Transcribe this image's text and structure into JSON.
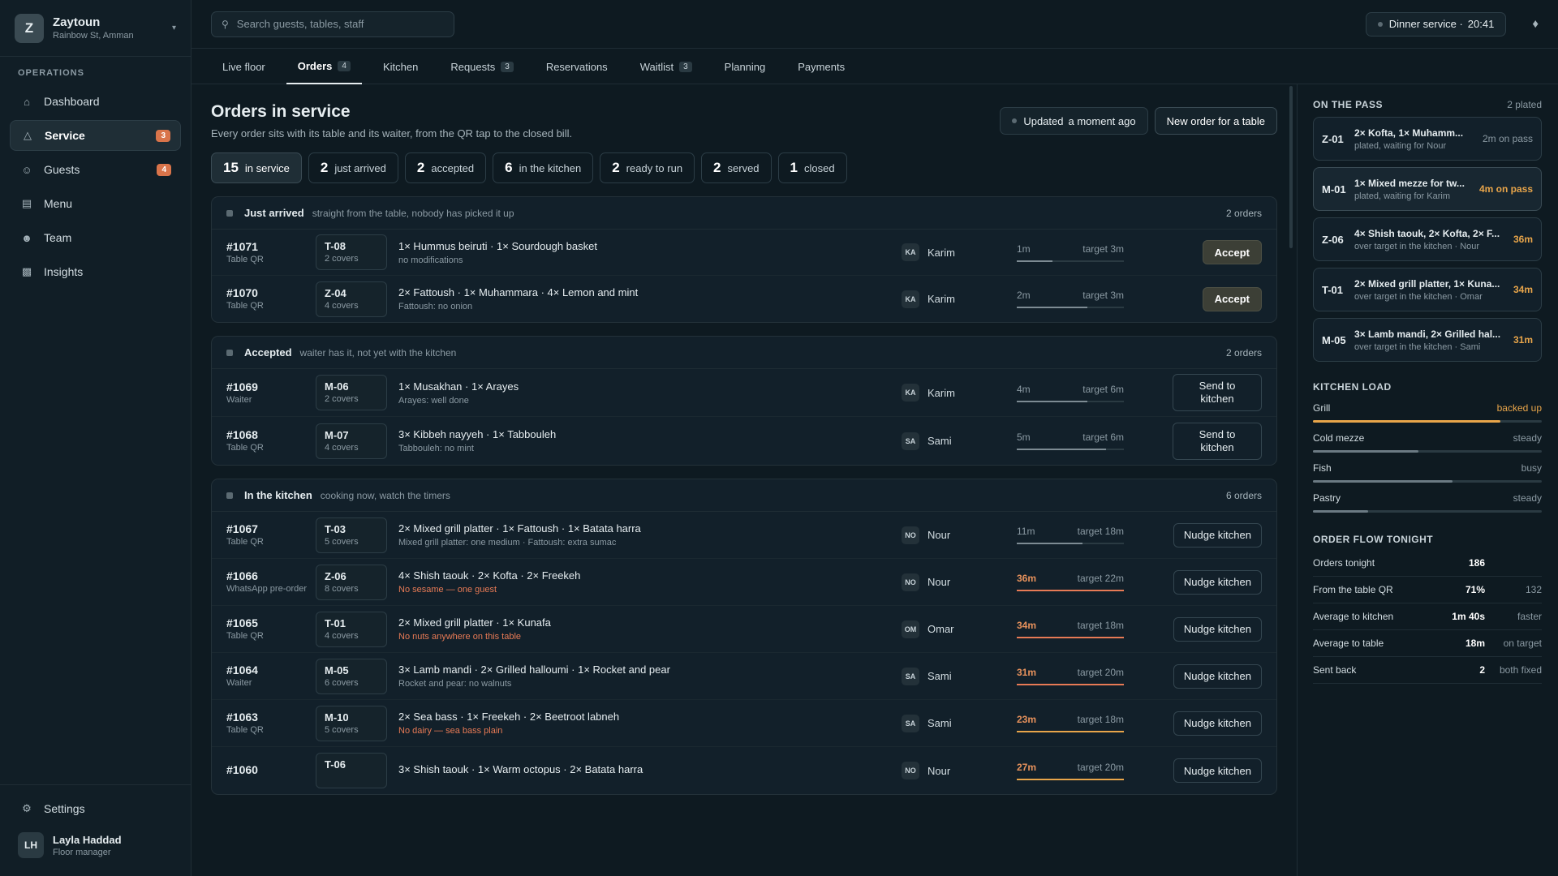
{
  "brand": {
    "initial": "Z",
    "name": "Zaytoun",
    "location": "Rainbow St, Amman"
  },
  "sidebar": {
    "section": "OPERATIONS",
    "items": [
      {
        "label": "Dashboard",
        "icon": "home-icon",
        "badge": ""
      },
      {
        "label": "Service",
        "icon": "service-bell-icon",
        "badge": "3"
      },
      {
        "label": "Guests",
        "icon": "users-icon",
        "badge": "4"
      },
      {
        "label": "Menu",
        "icon": "book-icon",
        "badge": ""
      },
      {
        "label": "Team",
        "icon": "team-icon",
        "badge": ""
      },
      {
        "label": "Insights",
        "icon": "chart-icon",
        "badge": ""
      }
    ],
    "settings": "Settings",
    "user": {
      "initials": "LH",
      "name": "Layla Haddad",
      "role": "Floor manager"
    }
  },
  "topbar": {
    "search_placeholder": "Search guests, tables, staff",
    "service_label": "Dinner service ·",
    "service_time": "20:41"
  },
  "tabs": [
    {
      "label": "Live floor",
      "count": ""
    },
    {
      "label": "Orders",
      "count": "4"
    },
    {
      "label": "Kitchen",
      "count": ""
    },
    {
      "label": "Requests",
      "count": "3"
    },
    {
      "label": "Reservations",
      "count": ""
    },
    {
      "label": "Waitlist",
      "count": "3"
    },
    {
      "label": "Planning",
      "count": ""
    },
    {
      "label": "Payments",
      "count": ""
    }
  ],
  "page": {
    "title": "Orders in service",
    "subtitle": "Every order sits with its table and its waiter, from the QR tap to the closed bill.",
    "updated_label": "Updated",
    "updated_value": "a moment ago",
    "new_order": "New order for a table"
  },
  "filters": [
    {
      "num": "15",
      "label": "in service"
    },
    {
      "num": "2",
      "label": "just arrived"
    },
    {
      "num": "2",
      "label": "accepted"
    },
    {
      "num": "6",
      "label": "in the kitchen"
    },
    {
      "num": "2",
      "label": "ready to run"
    },
    {
      "num": "2",
      "label": "served"
    },
    {
      "num": "1",
      "label": "closed"
    }
  ],
  "groups": [
    {
      "title": "Just arrived",
      "subtitle": "straight from the table, nobody has picked it up",
      "count": "2 orders",
      "orders": [
        {
          "id": "#1071",
          "source": "Table QR",
          "table": "T-08",
          "covers": "2 covers",
          "items": "1× Hummus beiruti · 1× Sourdough basket",
          "note": "no modifications",
          "alert": false,
          "waiter_initials": "KA",
          "waiter": "Karim",
          "elapsed": "1m",
          "target": "target 3m",
          "progress": 0.33,
          "state": "normal",
          "action": "Accept",
          "action_type": "accept"
        },
        {
          "id": "#1070",
          "source": "Table QR",
          "table": "Z-04",
          "covers": "4 covers",
          "items": "2× Fattoush · 1× Muhammara · 4× Lemon and mint",
          "note": "Fattoush: no onion",
          "alert": false,
          "waiter_initials": "KA",
          "waiter": "Karim",
          "elapsed": "2m",
          "target": "target 3m",
          "progress": 0.66,
          "state": "normal",
          "action": "Accept",
          "action_type": "accept"
        }
      ]
    },
    {
      "title": "Accepted",
      "subtitle": "waiter has it, not yet with the kitchen",
      "count": "2 orders",
      "orders": [
        {
          "id": "#1069",
          "source": "Waiter",
          "table": "M-06",
          "covers": "2 covers",
          "items": "1× Musakhan · 1× Arayes",
          "note": "Arayes: well done",
          "alert": false,
          "waiter_initials": "KA",
          "waiter": "Karim",
          "elapsed": "4m",
          "target": "target 6m",
          "progress": 0.66,
          "state": "normal",
          "action": "Send to kitchen",
          "action_type": "send"
        },
        {
          "id": "#1068",
          "source": "Table QR",
          "table": "M-07",
          "covers": "4 covers",
          "items": "3× Kibbeh nayyeh · 1× Tabbouleh",
          "note": "Tabbouleh: no mint",
          "alert": false,
          "waiter_initials": "SA",
          "waiter": "Sami",
          "elapsed": "5m",
          "target": "target 6m",
          "progress": 0.83,
          "state": "normal",
          "action": "Send to kitchen",
          "action_type": "send"
        }
      ]
    },
    {
      "title": "In the kitchen",
      "subtitle": "cooking now, watch the timers",
      "count": "6 orders",
      "orders": [
        {
          "id": "#1067",
          "source": "Table QR",
          "table": "T-03",
          "covers": "5 covers",
          "items": "2× Mixed grill platter · 1× Fattoush · 1× Batata harra",
          "note": "Mixed grill platter: one medium · Fattoush: extra sumac",
          "alert": false,
          "waiter_initials": "NO",
          "waiter": "Nour",
          "elapsed": "11m",
          "target": "target 18m",
          "progress": 0.61,
          "state": "normal",
          "action": "Nudge kitchen",
          "action_type": "nudge"
        },
        {
          "id": "#1066",
          "source": "WhatsApp pre-order",
          "table": "Z-06",
          "covers": "8 covers",
          "items": "4× Shish taouk · 2× Kofta · 2× Freekeh",
          "note": "No sesame — one guest",
          "alert": true,
          "waiter_initials": "NO",
          "waiter": "Nour",
          "elapsed": "36m",
          "target": "target 22m",
          "progress": 1,
          "state": "late",
          "action": "Nudge kitchen",
          "action_type": "nudge"
        },
        {
          "id": "#1065",
          "source": "Table QR",
          "table": "T-01",
          "covers": "4 covers",
          "items": "2× Mixed grill platter · 1× Kunafa",
          "note": "No nuts anywhere on this table",
          "alert": true,
          "waiter_initials": "OM",
          "waiter": "Omar",
          "elapsed": "34m",
          "target": "target 18m",
          "progress": 1,
          "state": "late",
          "action": "Nudge kitchen",
          "action_type": "nudge"
        },
        {
          "id": "#1064",
          "source": "Waiter",
          "table": "M-05",
          "covers": "6 covers",
          "items": "3× Lamb mandi · 2× Grilled halloumi · 1× Rocket and pear",
          "note": "Rocket and pear: no walnuts",
          "alert": false,
          "waiter_initials": "SA",
          "waiter": "Sami",
          "elapsed": "31m",
          "target": "target 20m",
          "progress": 1,
          "state": "late",
          "action": "Nudge kitchen",
          "action_type": "nudge"
        },
        {
          "id": "#1063",
          "source": "Table QR",
          "table": "M-10",
          "covers": "5 covers",
          "items": "2× Sea bass · 1× Freekeh · 2× Beetroot labneh",
          "note": "No dairy — sea bass plain",
          "alert": true,
          "waiter_initials": "SA",
          "waiter": "Sami",
          "elapsed": "23m",
          "target": "target 18m",
          "progress": 1,
          "state": "warn",
          "action": "Nudge kitchen",
          "action_type": "nudge"
        },
        {
          "id": "#1060",
          "source": "",
          "table": "T-06",
          "covers": "",
          "items": "3× Shish taouk · 1× Warm octopus · 2× Batata harra",
          "note": "",
          "alert": false,
          "waiter_initials": "NO",
          "waiter": "Nour",
          "elapsed": "27m",
          "target": "target 20m",
          "progress": 1,
          "state": "warn",
          "action": "Nudge kitchen",
          "action_type": "nudge"
        }
      ]
    }
  ],
  "right": {
    "pass_title": "ON THE PASS",
    "pass_meta": "2 plated",
    "pass": [
      {
        "table": "Z-01",
        "items": "2× Kofta, 1× Muhamm...",
        "sub": "plated, waiting for Nour",
        "time": "2m on pass",
        "warn": false
      },
      {
        "table": "M-01",
        "items": "1× Mixed mezze for tw...",
        "sub": "plated, waiting for Karim",
        "time": "4m on pass",
        "warn": true
      },
      {
        "table": "Z-06",
        "items": "4× Shish taouk, 2× Kofta, 2× F...",
        "sub": "over target in the kitchen · Nour",
        "time": "36m",
        "warn": true
      },
      {
        "table": "T-01",
        "items": "2× Mixed grill platter, 1× Kuna...",
        "sub": "over target in the kitchen · Omar",
        "time": "34m",
        "warn": true
      },
      {
        "table": "M-05",
        "items": "3× Lamb mandi, 2× Grilled hal...",
        "sub": "over target in the kitchen · Sami",
        "time": "31m",
        "warn": true
      }
    ],
    "load_title": "KITCHEN LOAD",
    "load": [
      {
        "name": "Grill",
        "status": "backed up",
        "level": 0.82,
        "alert": true
      },
      {
        "name": "Cold mezze",
        "status": "steady",
        "level": 0.46,
        "alert": false
      },
      {
        "name": "Fish",
        "status": "busy",
        "level": 0.61,
        "alert": false
      },
      {
        "name": "Pastry",
        "status": "steady",
        "level": 0.24,
        "alert": false
      }
    ],
    "flow_title": "ORDER FLOW TONIGHT",
    "flow": [
      {
        "label": "Orders tonight",
        "value": "186",
        "note": ""
      },
      {
        "label": "From the table QR",
        "value": "71%",
        "note": "132"
      },
      {
        "label": "Average to kitchen",
        "value": "1m 40s",
        "note": "faster"
      },
      {
        "label": "Average to table",
        "value": "18m",
        "note": "on target"
      },
      {
        "label": "Sent back",
        "value": "2",
        "note": "both fixed"
      }
    ]
  },
  "colors": {
    "accent_late": "#e77a55",
    "accent_warn": "#e8a54a",
    "badge": "#d9744a"
  }
}
